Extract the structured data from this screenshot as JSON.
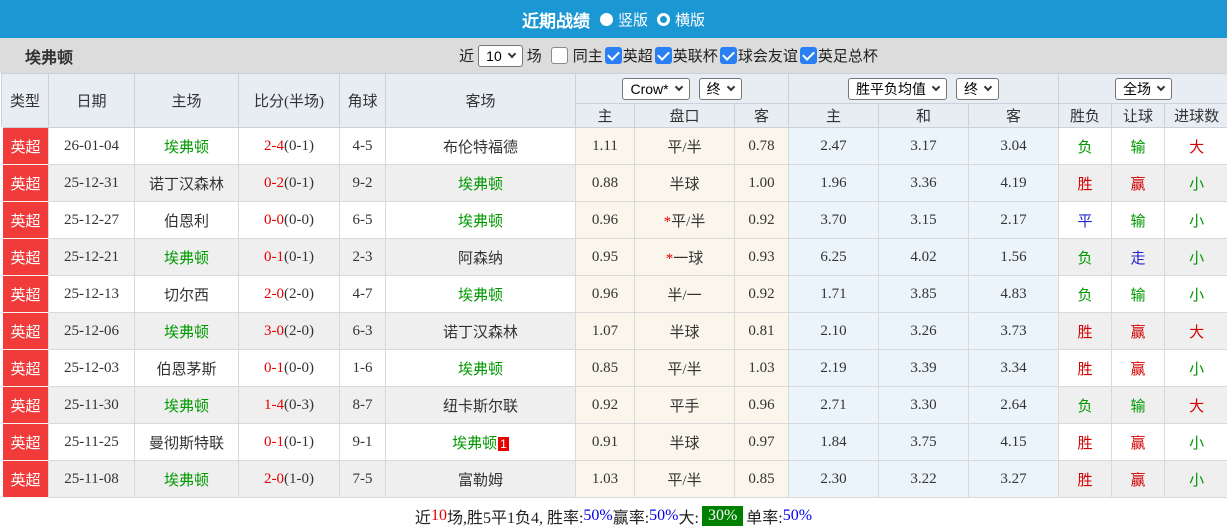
{
  "title_bar": {
    "title": "近期战绩",
    "radios": [
      {
        "label": "竖版",
        "selected": true
      },
      {
        "label": "横版",
        "selected": false
      }
    ]
  },
  "filter_bar": {
    "team": "埃弗顿",
    "near_label": "近",
    "matches_value": "10",
    "matches_label": "场",
    "checkboxes": [
      {
        "label": "同主",
        "checked": false
      },
      {
        "label": "英超",
        "checked": true
      },
      {
        "label": "英联杯",
        "checked": true
      },
      {
        "label": "球会友谊",
        "checked": true
      },
      {
        "label": "英足总杯",
        "checked": true
      }
    ]
  },
  "table": {
    "columns": [
      "类型",
      "日期",
      "主场",
      "比分(半场)",
      "角球",
      "客场"
    ],
    "odds_group": {
      "select1": "Crow*",
      "select2": "终",
      "sub": [
        "主",
        "盘口",
        "客"
      ]
    },
    "avg_group": {
      "select1": "胜平负均值",
      "select2": "终",
      "sub": [
        "主",
        "和",
        "客"
      ]
    },
    "result_group": {
      "select1": "全场",
      "sub": [
        "胜负",
        "让球",
        "进球数"
      ]
    },
    "colors": {
      "green": "#009900",
      "red": "#d40000",
      "blue": "#2525cd",
      "black": "#333333"
    },
    "type_color": "#f13a3a",
    "rows": [
      {
        "type": "英超",
        "date": "26-01-04",
        "home": "埃弗顿",
        "home_color": "green",
        "score": "2-4",
        "half": "(0-1)",
        "corner": "4-5",
        "away": "布伦特福德",
        "away_color": "black",
        "away_badge": "",
        "odds_home": "1.11",
        "handicap": "平/半",
        "odds_away": "0.78",
        "avg_home": "2.47",
        "avg_draw": "3.17",
        "avg_away": "3.04",
        "result": "负",
        "result_color": "green",
        "handicap_result": "输",
        "handicap_result_color": "green",
        "goals": "大",
        "goals_color": "red"
      },
      {
        "type": "英超",
        "date": "25-12-31",
        "home": "诺丁汉森林",
        "home_color": "black",
        "score": "0-2",
        "half": "(0-1)",
        "corner": "9-2",
        "away": "埃弗顿",
        "away_color": "green",
        "away_badge": "",
        "odds_home": "0.88",
        "handicap": "半球",
        "odds_away": "1.00",
        "avg_home": "1.96",
        "avg_draw": "3.36",
        "avg_away": "4.19",
        "result": "胜",
        "result_color": "red",
        "handicap_result": "赢",
        "handicap_result_color": "red",
        "goals": "小",
        "goals_color": "green"
      },
      {
        "type": "英超",
        "date": "25-12-27",
        "home": "伯恩利",
        "home_color": "black",
        "score": "0-0",
        "half": "(0-0)",
        "corner": "6-5",
        "away": "埃弗顿",
        "away_color": "green",
        "away_badge": "",
        "odds_home": "0.96",
        "handicap": "*平/半",
        "odds_away": "0.92",
        "avg_home": "3.70",
        "avg_draw": "3.15",
        "avg_away": "2.17",
        "result": "平",
        "result_color": "blue",
        "handicap_result": "输",
        "handicap_result_color": "green",
        "goals": "小",
        "goals_color": "green"
      },
      {
        "type": "英超",
        "date": "25-12-21",
        "home": "埃弗顿",
        "home_color": "green",
        "score": "0-1",
        "half": "(0-1)",
        "corner": "2-3",
        "away": "阿森纳",
        "away_color": "black",
        "away_badge": "",
        "odds_home": "0.95",
        "handicap": "*一球",
        "odds_away": "0.93",
        "avg_home": "6.25",
        "avg_draw": "4.02",
        "avg_away": "1.56",
        "result": "负",
        "result_color": "green",
        "handicap_result": "走",
        "handicap_result_color": "blue",
        "goals": "小",
        "goals_color": "green"
      },
      {
        "type": "英超",
        "date": "25-12-13",
        "home": "切尔西",
        "home_color": "black",
        "score": "2-0",
        "half": "(2-0)",
        "corner": "4-7",
        "away": "埃弗顿",
        "away_color": "green",
        "away_badge": "",
        "odds_home": "0.96",
        "handicap": "半/一",
        "odds_away": "0.92",
        "avg_home": "1.71",
        "avg_draw": "3.85",
        "avg_away": "4.83",
        "result": "负",
        "result_color": "green",
        "handicap_result": "输",
        "handicap_result_color": "green",
        "goals": "小",
        "goals_color": "green"
      },
      {
        "type": "英超",
        "date": "25-12-06",
        "home": "埃弗顿",
        "home_color": "green",
        "score": "3-0",
        "half": "(2-0)",
        "corner": "6-3",
        "away": "诺丁汉森林",
        "away_color": "black",
        "away_badge": "",
        "odds_home": "1.07",
        "handicap": "半球",
        "odds_away": "0.81",
        "avg_home": "2.10",
        "avg_draw": "3.26",
        "avg_away": "3.73",
        "result": "胜",
        "result_color": "red",
        "handicap_result": "赢",
        "handicap_result_color": "red",
        "goals": "大",
        "goals_color": "red"
      },
      {
        "type": "英超",
        "date": "25-12-03",
        "home": "伯恩茅斯",
        "home_color": "black",
        "score": "0-1",
        "half": "(0-0)",
        "corner": "1-6",
        "away": "埃弗顿",
        "away_color": "green",
        "away_badge": "",
        "odds_home": "0.85",
        "handicap": "平/半",
        "odds_away": "1.03",
        "avg_home": "2.19",
        "avg_draw": "3.39",
        "avg_away": "3.34",
        "result": "胜",
        "result_color": "red",
        "handicap_result": "赢",
        "handicap_result_color": "red",
        "goals": "小",
        "goals_color": "green"
      },
      {
        "type": "英超",
        "date": "25-11-30",
        "home": "埃弗顿",
        "home_color": "green",
        "score": "1-4",
        "half": "(0-3)",
        "corner": "8-7",
        "away": "纽卡斯尔联",
        "away_color": "black",
        "away_badge": "",
        "odds_home": "0.92",
        "handicap": "平手",
        "odds_away": "0.96",
        "avg_home": "2.71",
        "avg_draw": "3.30",
        "avg_away": "2.64",
        "result": "负",
        "result_color": "green",
        "handicap_result": "输",
        "handicap_result_color": "green",
        "goals": "大",
        "goals_color": "red"
      },
      {
        "type": "英超",
        "date": "25-11-25",
        "home": "曼彻斯特联",
        "home_color": "black",
        "score": "0-1",
        "half": "(0-1)",
        "corner": "9-1",
        "away": "埃弗顿",
        "away_color": "green",
        "away_badge": "1",
        "odds_home": "0.91",
        "handicap": "半球",
        "odds_away": "0.97",
        "avg_home": "1.84",
        "avg_draw": "3.75",
        "avg_away": "4.15",
        "result": "胜",
        "result_color": "red",
        "handicap_result": "赢",
        "handicap_result_color": "red",
        "goals": "小",
        "goals_color": "green"
      },
      {
        "type": "英超",
        "date": "25-11-08",
        "home": "埃弗顿",
        "home_color": "green",
        "score": "2-0",
        "half": "(1-0)",
        "corner": "7-5",
        "away": "富勒姆",
        "away_color": "black",
        "away_badge": "",
        "odds_home": "1.03",
        "handicap": "平/半",
        "odds_away": "0.85",
        "avg_home": "2.30",
        "avg_draw": "3.22",
        "avg_away": "3.27",
        "result": "胜",
        "result_color": "red",
        "handicap_result": "赢",
        "handicap_result_color": "red",
        "goals": "小",
        "goals_color": "green"
      }
    ]
  },
  "footer": {
    "segments": [
      {
        "text": "近",
        "style": "black"
      },
      {
        "text": "10",
        "style": "red"
      },
      {
        "text": "场,胜5平1负4, 胜率:",
        "style": "black"
      },
      {
        "text": "50%",
        "style": "blue"
      },
      {
        "text": " 赢率:",
        "style": "black"
      },
      {
        "text": "50%",
        "style": "blue"
      },
      {
        "text": " 大:",
        "style": "black"
      },
      {
        "text": "30%",
        "style": "badge"
      },
      {
        "text": " 单率:",
        "style": "black"
      },
      {
        "text": "50%",
        "style": "blue"
      }
    ]
  }
}
